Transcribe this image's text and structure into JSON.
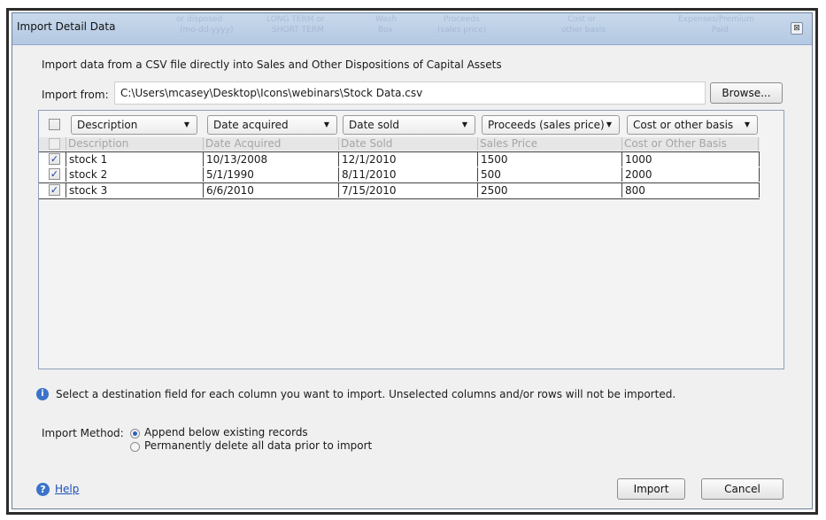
{
  "window": {
    "title": "Import Detail Data",
    "close_glyph": "⊠",
    "background_ghost_text": [
      "or disposed",
      "(mo-dd-yyyy)",
      "LONG TERM or",
      "SHORT TERM",
      "Wash",
      "Box",
      "Proceeds",
      "(sales price)",
      "Cost or",
      "other basis",
      "Expenses/Premium",
      "Paid"
    ]
  },
  "intro_text": "Import data from a CSV file directly into Sales and Other Dispositions of Capital Assets",
  "import_from": {
    "label": "Import from:",
    "path": "C:\\Users\\mcasey\\Desktop\\Icons\\webinars\\Stock Data.csv",
    "browse_label": "Browse..."
  },
  "grid": {
    "column_selects": [
      {
        "selected": "Description"
      },
      {
        "selected": "Date acquired"
      },
      {
        "selected": "Date sold"
      },
      {
        "selected": "Proceeds (sales price)"
      },
      {
        "selected": "Cost or other basis"
      }
    ],
    "header_row": [
      "Description",
      "Date Acquired",
      "Date Sold",
      "Sales Price",
      "Cost or Other Basis"
    ],
    "rows": [
      {
        "checked": true,
        "cells": [
          "stock 1",
          "10/13/2008",
          "12/1/2010",
          "1500",
          "1000"
        ]
      },
      {
        "checked": true,
        "cells": [
          "stock 2",
          "5/1/1990",
          "8/11/2010",
          "500",
          "2000"
        ]
      },
      {
        "checked": true,
        "cells": [
          "stock 3",
          "6/6/2010",
          "7/15/2010",
          "2500",
          "800"
        ]
      }
    ]
  },
  "info_text": "Select a destination field for each column you want to import. Unselected columns and/or rows will not be imported.",
  "import_method": {
    "label": "Import Method:",
    "options": [
      {
        "label": "Append below existing records",
        "selected": true
      },
      {
        "label": "Permanently delete all data prior to import",
        "selected": false
      }
    ]
  },
  "footer": {
    "help_label": "Help",
    "import_label": "Import",
    "cancel_label": "Cancel"
  },
  "icons": {
    "info": "info-icon",
    "help": "help-icon",
    "dropdown": "chevron-down-icon",
    "close": "close-icon"
  },
  "colors": {
    "titlebar": "#b9cce4",
    "link": "#1a4fb8",
    "info_icon": "#3b73c9"
  }
}
